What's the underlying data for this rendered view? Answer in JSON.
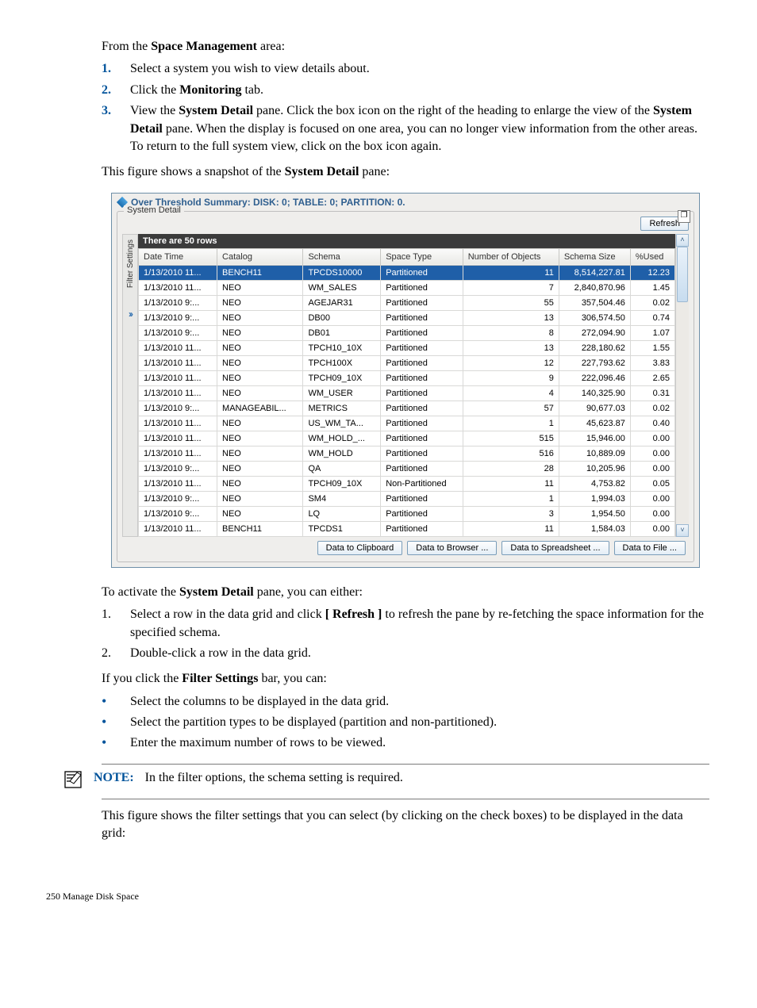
{
  "intro": "From the Space Management area:",
  "intro_bold": "Space Management",
  "steps1": [
    {
      "n": "1.",
      "t": "Select a system you wish to view details about."
    },
    {
      "n": "2.",
      "before": "Click the ",
      "bold": "Monitoring",
      "after": " tab."
    },
    {
      "n": "3.",
      "before": "View the ",
      "bold": "System Detail",
      "after": " pane. Click the box icon on the right of the heading to enlarge the view of the ",
      "bold2": "System Detail",
      "after2": " pane. When the display is focused on one area, you can no longer view information from the other areas. To return to the full system view, click on the box icon again."
    }
  ],
  "snapshot_line_before": "This figure shows a snapshot of the ",
  "snapshot_line_bold": "System Detail",
  "snapshot_line_after": " pane:",
  "ss": {
    "threshold": "Over Threshold Summary: DISK: 0; TABLE: 0; PARTITION: 0.",
    "legend": "System Detail",
    "refresh": "Refresh",
    "sidebar_label": "Filter Settings",
    "rowcount": "There are 50 rows",
    "headers": [
      "Date Time",
      "Catalog",
      "Schema",
      "Space Type",
      "Number of Objects",
      "Schema Size",
      "%Used"
    ],
    "rows": [
      {
        "sel": true,
        "c": [
          "1/13/2010 11...",
          "BENCH11",
          "TPCDS10000",
          "Partitioned",
          "11",
          "8,514,227.81",
          "12.23"
        ]
      },
      {
        "c": [
          "1/13/2010 11...",
          "NEO",
          "WM_SALES",
          "Partitioned",
          "7",
          "2,840,870.96",
          "1.45"
        ]
      },
      {
        "c": [
          "1/13/2010 9:...",
          "NEO",
          "AGEJAR31",
          "Partitioned",
          "55",
          "357,504.46",
          "0.02"
        ]
      },
      {
        "c": [
          "1/13/2010 9:...",
          "NEO",
          "DB00",
          "Partitioned",
          "13",
          "306,574.50",
          "0.74"
        ]
      },
      {
        "c": [
          "1/13/2010 9:...",
          "NEO",
          "DB01",
          "Partitioned",
          "8",
          "272,094.90",
          "1.07"
        ]
      },
      {
        "c": [
          "1/13/2010 11...",
          "NEO",
          "TPCH10_10X",
          "Partitioned",
          "13",
          "228,180.62",
          "1.55"
        ]
      },
      {
        "c": [
          "1/13/2010 11...",
          "NEO",
          "TPCH100X",
          "Partitioned",
          "12",
          "227,793.62",
          "3.83"
        ]
      },
      {
        "c": [
          "1/13/2010 11...",
          "NEO",
          "TPCH09_10X",
          "Partitioned",
          "9",
          "222,096.46",
          "2.65"
        ]
      },
      {
        "c": [
          "1/13/2010 11...",
          "NEO",
          "WM_USER",
          "Partitioned",
          "4",
          "140,325.90",
          "0.31"
        ]
      },
      {
        "c": [
          "1/13/2010 9:...",
          "MANAGEABIL...",
          "METRICS",
          "Partitioned",
          "57",
          "90,677.03",
          "0.02"
        ]
      },
      {
        "c": [
          "1/13/2010 11...",
          "NEO",
          "US_WM_TA...",
          "Partitioned",
          "1",
          "45,623.87",
          "0.40"
        ]
      },
      {
        "c": [
          "1/13/2010 11...",
          "NEO",
          "WM_HOLD_...",
          "Partitioned",
          "515",
          "15,946.00",
          "0.00"
        ]
      },
      {
        "c": [
          "1/13/2010 11...",
          "NEO",
          "WM_HOLD",
          "Partitioned",
          "516",
          "10,889.09",
          "0.00"
        ]
      },
      {
        "c": [
          "1/13/2010 9:...",
          "NEO",
          "QA",
          "Partitioned",
          "28",
          "10,205.96",
          "0.00"
        ]
      },
      {
        "c": [
          "1/13/2010 11...",
          "NEO",
          "TPCH09_10X",
          "Non-Partitioned",
          "11",
          "4,753.82",
          "0.05"
        ]
      },
      {
        "c": [
          "1/13/2010 9:...",
          "NEO",
          "SM4",
          "Partitioned",
          "1",
          "1,994.03",
          "0.00"
        ]
      },
      {
        "c": [
          "1/13/2010 9:...",
          "NEO",
          "LQ",
          "Partitioned",
          "3",
          "1,954.50",
          "0.00"
        ]
      },
      {
        "c": [
          "1/13/2010 11...",
          "BENCH11",
          "TPCDS1",
          "Partitioned",
          "11",
          "1,584.03",
          "0.00"
        ]
      }
    ],
    "buttons": [
      "Data to Clipboard",
      "Data to Browser ...",
      "Data to Spreadsheet ...",
      "Data to File ..."
    ]
  },
  "activate_before": "To activate the ",
  "activate_bold": "System Detail",
  "activate_after": " pane, you can either:",
  "steps2": [
    {
      "n": "1.",
      "before": "Select a row in the data grid and click ",
      "bold": "[ Refresh ]",
      "after": " to refresh the pane by re-fetching the space information for the specified schema."
    },
    {
      "n": "2.",
      "t": "Double-click a row in the data grid."
    }
  ],
  "filter_before": "If you click the ",
  "filter_bold": "Filter Settings",
  "filter_after": " bar, you can:",
  "bullets": [
    "Select the columns to be displayed in the data grid.",
    "Select the partition types to be displayed (partition and non-partitioned).",
    "Enter the maximum number of rows to be viewed."
  ],
  "note_label": "NOTE:",
  "note_text": "In the filter options, the schema setting is required.",
  "closing": "This figure shows the filter settings that you can select (by clicking on the check boxes) to be displayed in the data grid:",
  "footer": "250   Manage Disk Space"
}
